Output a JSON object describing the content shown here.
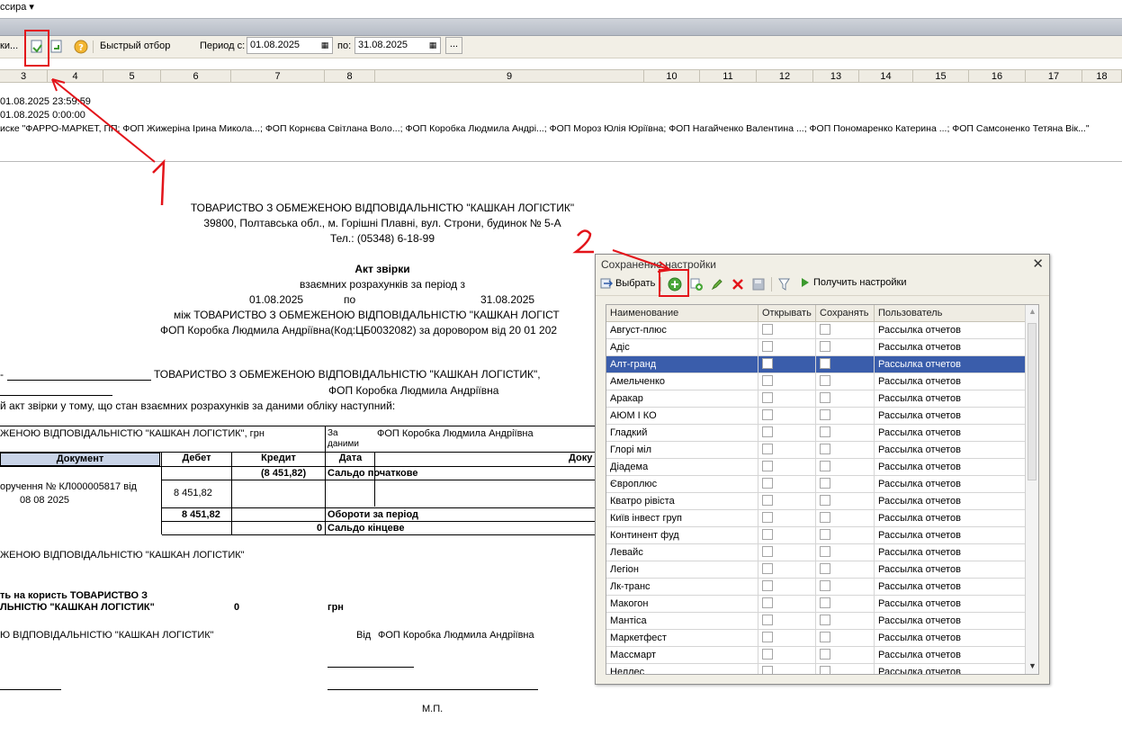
{
  "topbar": {
    "title": "ссира ▾"
  },
  "toolbar": {
    "left_fragment": "ки...",
    "quick_filter": "Быстрый отбор",
    "period_from_label": "Период с:",
    "period_from": "01.08.2025",
    "period_to_label": "по:",
    "period_to": "31.08.2025",
    "more": "..."
  },
  "ruler": [
    "3",
    "4",
    "5",
    "6",
    "7",
    "8",
    "9",
    "10",
    "11",
    "12",
    "13",
    "14",
    "15",
    "16",
    "17",
    "18"
  ],
  "report_header": {
    "line1": "01.08.2025 23:59:59",
    "line2": "01.08.2025 0:00:00",
    "line3": "иске \"ФАРРО-МАРКЕТ, ПП; ФОП Жижеріна Ірина Микола...; ФОП Корнєва Світлана Воло...; ФОП Коробка Людмила Андрі...; ФОП Мороз Юлія Юріївна; ФОП Нагайченко Валентина ...; ФОП Пономаренко Катерина ...; ФОП Самсоненко Тетяна Вік...\""
  },
  "doc": {
    "company": "ТОВАРИСТВО З ОБМЕЖЕНОЮ ВІДПОВІДАЛЬНІСТЮ \"КАШКАН ЛОГІСТИК\"",
    "address": "39800, Полтавська обл., м. Горішні Плавні, вул. Строни, будинок № 5-А",
    "phone": "Тел.: (05348) 6-18-99",
    "act_title": "Акт звірки",
    "subtitle": "взаємних розрахунків за період з",
    "date_from": "01.08.2025",
    "po": "по",
    "date_to": "31.08.2025",
    "between": "між ТОВАРИСТВО З ОБМЕЖЕНОЮ ВІДПОВІДАЛЬНІСТЮ \"КАШКАН ЛОГІСТ",
    "fop_contract": "ФОП Коробка Людмила Андріївна(Код:ЦБ0032082) за доровором  від 20 01 202",
    "party1": "ТОВАРИСТВО З ОБМЕЖЕНОЮ ВІДПОВІДАЛЬНІСТЮ \"КАШКАН ЛОГІСТИК\",",
    "party2": "ФОП Коробка Людмила Андріївна",
    "intro": "й акт звірки у тому, що стан взаємних розрахунків за даними обліку наступний:",
    "by_company": "ЖЕНОЮ ВІДПОВІДАЛЬНІСТЮ \"КАШКАН ЛОГІСТИК\", грн",
    "za_danymy": "За даними",
    "by_fop": "ФОП Коробка Людмила Андріївна",
    "col_doc": "Документ",
    "col_debet": "Дебет",
    "col_credit": "Кредит",
    "col_date": "Дата",
    "col_doc2": "Доку",
    "opening_value": "(8 451,82)",
    "opening_label": "Сальдо початкове",
    "payment_line1": "оручення  № КЛ000005817 від",
    "payment_line2": "08 08 2025",
    "payment_debet": "8 451,82",
    "turnover_value": "8 451,82",
    "turnover_label": "Обороти за період",
    "closing_value": "0",
    "closing_label": "Сальдо кінцеве",
    "company_footer": "ЖЕНОЮ ВІДПОВІДАЛЬНІСТЮ \"КАШКАН ЛОГІСТИК\"",
    "in_favor1": "ть на користь ТОВАРИСТВО З",
    "in_favor2": "ЛЬНІСТЮ \"КАШКАН ЛОГІСТИК\"",
    "favor_value": "0",
    "grn": "грн",
    "sign_company": "Ю ВІДПОВІДАЛЬНІСТЮ \"КАШКАН ЛОГІСТИК\"",
    "sign_vid": "Від",
    "sign_fop": "ФОП Коробка Людмила Андріївна",
    "mp": "М.П."
  },
  "annotations": {
    "arrow1": "1",
    "arrow2": "2"
  },
  "dialog": {
    "title": "Сохранение настройки",
    "select_btn": "Выбрать",
    "get_settings_btn": "Получить настройки",
    "columns": [
      "Наименование",
      "Открывать",
      "Сохранять",
      "Пользователь"
    ],
    "rows": [
      {
        "name": "Август-плюс",
        "user": "Рассылка отчетов"
      },
      {
        "name": "Адіс",
        "user": "Рассылка отчетов"
      },
      {
        "name": "Алт-гранд",
        "user": "Рассылка отчетов",
        "selected": true
      },
      {
        "name": "Амельченко",
        "user": "Рассылка отчетов"
      },
      {
        "name": "Аракар",
        "user": "Рассылка отчетов"
      },
      {
        "name": "АЮМ І КО",
        "user": "Рассылка отчетов"
      },
      {
        "name": "Гладкий",
        "user": "Рассылка отчетов"
      },
      {
        "name": "Глорі міл",
        "user": "Рассылка отчетов"
      },
      {
        "name": "Діадема",
        "user": "Рассылка отчетов"
      },
      {
        "name": "Європлюс",
        "user": "Рассылка отчетов"
      },
      {
        "name": "Кватро рівіста",
        "user": "Рассылка отчетов"
      },
      {
        "name": "Київ інвест груп",
        "user": "Рассылка отчетов"
      },
      {
        "name": "Континент фуд",
        "user": "Рассылка отчетов"
      },
      {
        "name": "Левайс",
        "user": "Рассылка отчетов"
      },
      {
        "name": "Легіон",
        "user": "Рассылка отчетов"
      },
      {
        "name": "Лк-транс",
        "user": "Рассылка отчетов"
      },
      {
        "name": "Макогон",
        "user": "Рассылка отчетов"
      },
      {
        "name": "Мантіса",
        "user": "Рассылка отчетов"
      },
      {
        "name": "Маркетфест",
        "user": "Рассылка отчетов"
      },
      {
        "name": "Массмарт",
        "user": "Рассылка отчетов"
      },
      {
        "name": "Неллес",
        "user": "Рассылка отчетов"
      }
    ]
  }
}
